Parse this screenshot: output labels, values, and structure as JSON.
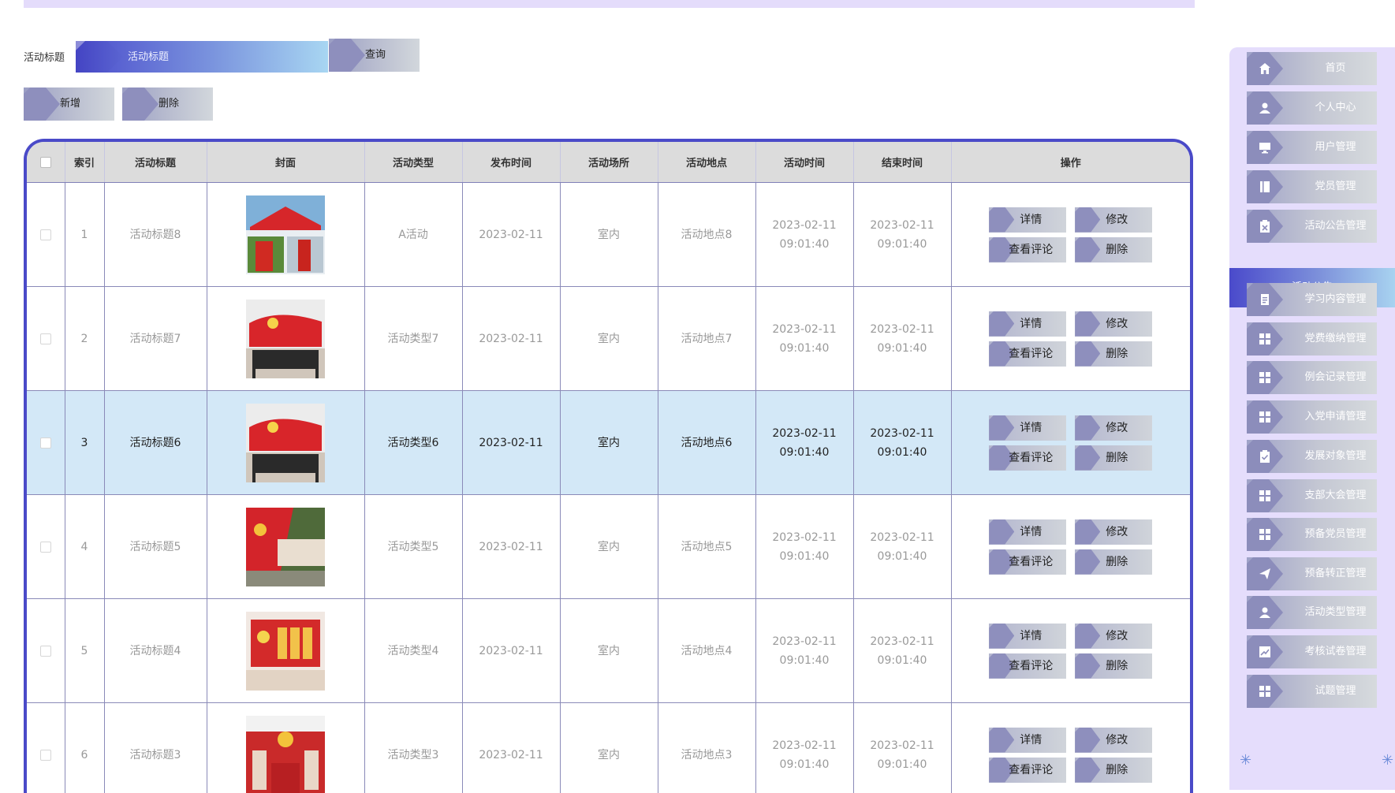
{
  "search": {
    "label": "活动标题",
    "placeholder": "活动标题",
    "query_label": "查询"
  },
  "toolbar": {
    "add_label": "新增",
    "delete_label": "删除"
  },
  "table": {
    "headers": [
      "索引",
      "活动标题",
      "封面",
      "活动类型",
      "发布时间",
      "活动场所",
      "活动地点",
      "活动时间",
      "结束时间",
      "操作"
    ],
    "rows": [
      {
        "index": "1",
        "title": "活动标题8",
        "type": "A活动",
        "publish": "2023-02-11",
        "venue": "室内",
        "place": "活动地点8",
        "start": "2023-02-11 09:01:40",
        "end": "2023-02-11 09:01:40"
      },
      {
        "index": "2",
        "title": "活动标题7",
        "type": "活动类型7",
        "publish": "2023-02-11",
        "venue": "室内",
        "place": "活动地点7",
        "start": "2023-02-11 09:01:40",
        "end": "2023-02-11 09:01:40"
      },
      {
        "index": "3",
        "title": "活动标题6",
        "type": "活动类型6",
        "publish": "2023-02-11",
        "venue": "室内",
        "place": "活动地点6",
        "start": "2023-02-11 09:01:40",
        "end": "2023-02-11 09:01:40"
      },
      {
        "index": "4",
        "title": "活动标题5",
        "type": "活动类型5",
        "publish": "2023-02-11",
        "venue": "室内",
        "place": "活动地点5",
        "start": "2023-02-11 09:01:40",
        "end": "2023-02-11 09:01:40"
      },
      {
        "index": "5",
        "title": "活动标题4",
        "type": "活动类型4",
        "publish": "2023-02-11",
        "venue": "室内",
        "place": "活动地点4",
        "start": "2023-02-11 09:01:40",
        "end": "2023-02-11 09:01:40"
      },
      {
        "index": "6",
        "title": "活动标题3",
        "type": "活动类型3",
        "publish": "2023-02-11",
        "venue": "室内",
        "place": "活动地点3",
        "start": "2023-02-11 09:01:40",
        "end": "2023-02-11 09:01:40"
      }
    ],
    "ops": {
      "detail": "详情",
      "edit": "修改",
      "comments": "查看评论",
      "delete": "删除"
    }
  },
  "sidebar": {
    "items": [
      {
        "label": "首页",
        "icon": "home-icon"
      },
      {
        "label": "个人中心",
        "icon": "user-icon"
      },
      {
        "label": "用户管理",
        "icon": "monitor-icon"
      },
      {
        "label": "党员管理",
        "icon": "book-icon"
      },
      {
        "label": "活动公告管理",
        "icon": "clipboard-x-icon"
      },
      {
        "label": "学习内容管理",
        "icon": "document-icon"
      },
      {
        "label": "党费缴纳管理",
        "icon": "grid-icon"
      },
      {
        "label": "例会记录管理",
        "icon": "grid-icon"
      },
      {
        "label": "入党申请管理",
        "icon": "grid-icon"
      },
      {
        "label": "发展对象管理",
        "icon": "clipboard-check-icon"
      },
      {
        "label": "支部大会管理",
        "icon": "grid-icon"
      },
      {
        "label": "预备党员管理",
        "icon": "grid-icon"
      },
      {
        "label": "预备转正管理",
        "icon": "send-icon"
      },
      {
        "label": "活动类型管理",
        "icon": "user-icon"
      },
      {
        "label": "考核试卷管理",
        "icon": "chart-icon"
      },
      {
        "label": "试题管理",
        "icon": "grid-icon"
      }
    ],
    "active_label": "活动公告"
  },
  "colors": {
    "accent": "#4a4ac8",
    "sidebar_bg": "#e5ddfc",
    "highlight_row": "#d3e8f7"
  }
}
